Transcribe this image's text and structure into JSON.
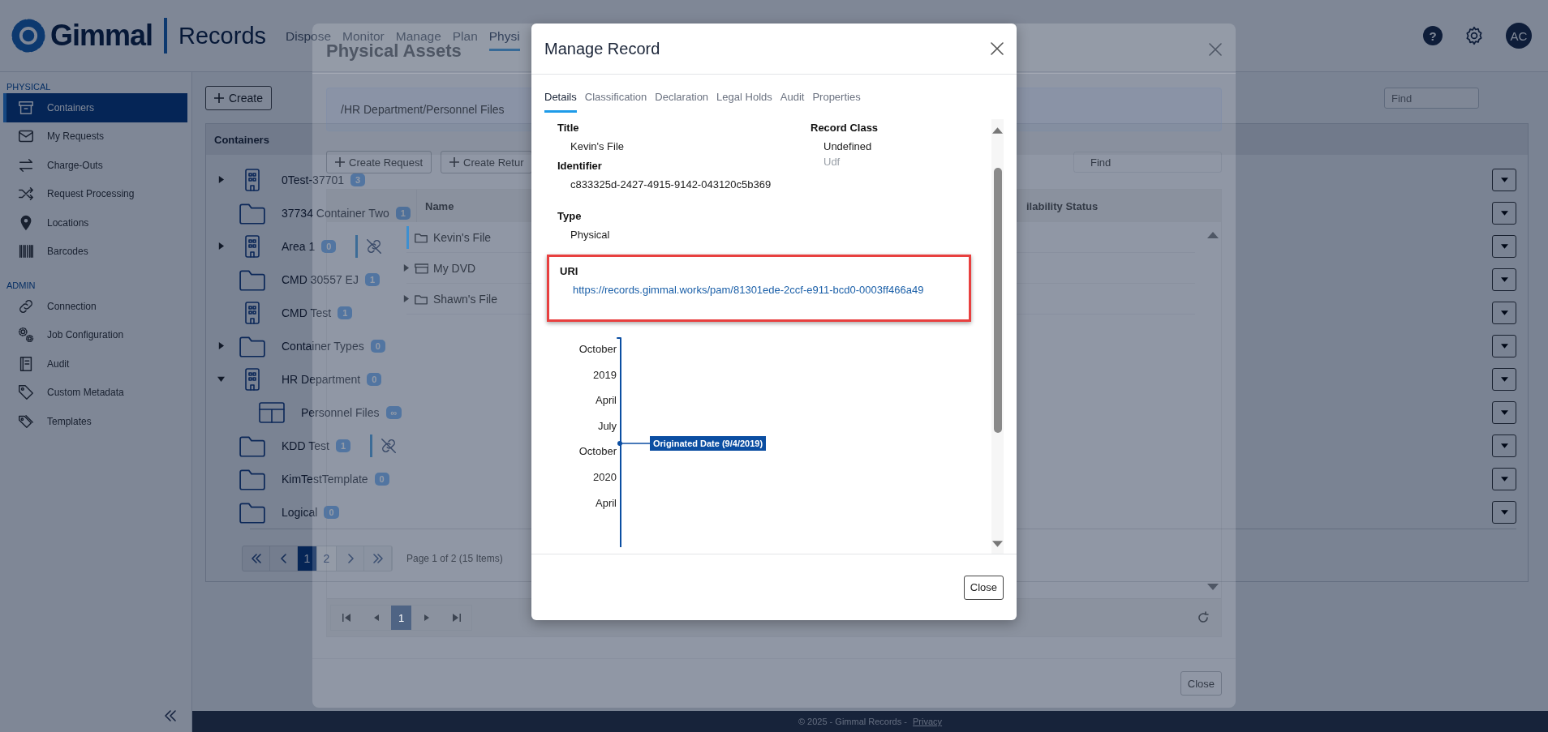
{
  "header": {
    "brand": "Gimmal",
    "product": "Records",
    "nav": [
      {
        "label": "Dispose",
        "selected": false
      },
      {
        "label": "Monitor",
        "selected": false
      },
      {
        "label": "Manage",
        "selected": false
      },
      {
        "label": "Plan",
        "selected": false
      },
      {
        "label": "Physi",
        "selected": true
      }
    ],
    "help": "?",
    "avatar": "AC"
  },
  "sidebar": {
    "sections": [
      {
        "heading": "PHYSICAL",
        "items": [
          {
            "label": "Containers",
            "selected": true
          },
          {
            "label": "My Requests",
            "selected": false
          },
          {
            "label": "Charge-Outs",
            "selected": false
          },
          {
            "label": "Request Processing",
            "selected": false
          },
          {
            "label": "Locations",
            "selected": false
          },
          {
            "label": "Barcodes",
            "selected": false
          }
        ]
      },
      {
        "heading": "ADMIN",
        "items": [
          {
            "label": "Connection",
            "selected": false
          },
          {
            "label": "Job Configuration",
            "selected": false
          },
          {
            "label": "Audit",
            "selected": false
          },
          {
            "label": "Custom Metadata",
            "selected": false
          },
          {
            "label": "Templates",
            "selected": false
          }
        ]
      }
    ]
  },
  "main": {
    "create_button": "Create",
    "search": {
      "placeholder": "Find"
    },
    "panel": {
      "title": "Containers",
      "rows": [
        {
          "name": "0Test-37701",
          "count": "3",
          "kind": "building",
          "expandable": true,
          "expanded": false,
          "unlinked": false
        },
        {
          "name": "37734 Container Two",
          "count": "1",
          "kind": "folder",
          "expandable": false,
          "expanded": false,
          "unlinked": false
        },
        {
          "name": "Area 1",
          "count": "0",
          "kind": "building",
          "expandable": true,
          "expanded": false,
          "unlinked": true
        },
        {
          "name": "CMD 30557 EJ",
          "count": "1",
          "kind": "folder",
          "expandable": false,
          "expanded": false,
          "unlinked": false
        },
        {
          "name": "CMD Test",
          "count": "1",
          "kind": "building",
          "expandable": false,
          "expanded": false,
          "unlinked": false
        },
        {
          "name": "Container Types",
          "count": "0",
          "kind": "folder",
          "expandable": true,
          "expanded": false,
          "unlinked": false
        },
        {
          "name": "HR Department",
          "count": "0",
          "kind": "building",
          "expandable": true,
          "expanded": true,
          "unlinked": false,
          "children": [
            {
              "name": "Personnel Files",
              "count": "∞",
              "kind": "template",
              "expandable": false,
              "expanded": false,
              "unlinked": false
            }
          ]
        },
        {
          "name": "KDD Test",
          "count": "1",
          "kind": "folder",
          "expandable": false,
          "expanded": false,
          "unlinked": true
        },
        {
          "name": "KimTestTemplate",
          "count": "0",
          "kind": "folder",
          "expandable": false,
          "expanded": false,
          "unlinked": false
        },
        {
          "name": "Logical",
          "count": "0",
          "kind": "folder",
          "expandable": false,
          "expanded": false,
          "unlinked": false
        }
      ],
      "pages": [
        {
          "label": "1",
          "selected": true
        },
        {
          "label": "2",
          "selected": false
        }
      ],
      "page_info": "Page 1 of 2 (15 Items)"
    }
  },
  "footer": {
    "text": "© 2025 - Gimmal Records -",
    "link": "Privacy"
  },
  "assets_dialog": {
    "title": "Physical Assets",
    "path": "/HR Department/Personnel Files",
    "actions": [
      "Create Request",
      "Create Retur"
    ],
    "search": {
      "placeholder": "Find"
    },
    "columns": [
      "Name",
      "ilability Status"
    ],
    "rows": [
      {
        "name": "Kevin's File",
        "kind": "folder",
        "expandable": false,
        "selected": true
      },
      {
        "name": "My DVD",
        "kind": "media",
        "expandable": true,
        "selected": false
      },
      {
        "name": "Shawn's File",
        "kind": "folder",
        "expandable": true,
        "selected": false
      }
    ],
    "pages": [
      {
        "label": "1",
        "selected": true
      }
    ],
    "close_button": "Close"
  },
  "record_dialog": {
    "title": "Manage Record",
    "tabs": [
      {
        "label": "Details",
        "selected": true
      },
      {
        "label": "Classification",
        "selected": false
      },
      {
        "label": "Declaration",
        "selected": false
      },
      {
        "label": "Legal Holds",
        "selected": false
      },
      {
        "label": "Audit",
        "selected": false
      },
      {
        "label": "Properties",
        "selected": false
      }
    ],
    "columns": [
      [
        {
          "label": "Title",
          "value": "Kevin's File"
        },
        {
          "label": "Identifier",
          "value": "c833325d-2427-4915-9142-043120c5b369"
        },
        {
          "label": "Type",
          "value": "Physical"
        }
      ],
      [
        {
          "label": "Record Class",
          "value": "Undefined",
          "secondary": "Udf"
        }
      ]
    ],
    "uri": {
      "label": "URI",
      "value": "https://records.gimmal.works/pam/81301ede-2ccf-e911-bcd0-0003ff466a49",
      "highlighted": true
    },
    "timeline": {
      "labels": [
        "October",
        "2019",
        "April",
        "July",
        "October",
        "2020",
        "April"
      ],
      "events": [
        {
          "label": "Originated Date (9/4/2019)"
        }
      ]
    },
    "close_button": "Close"
  }
}
